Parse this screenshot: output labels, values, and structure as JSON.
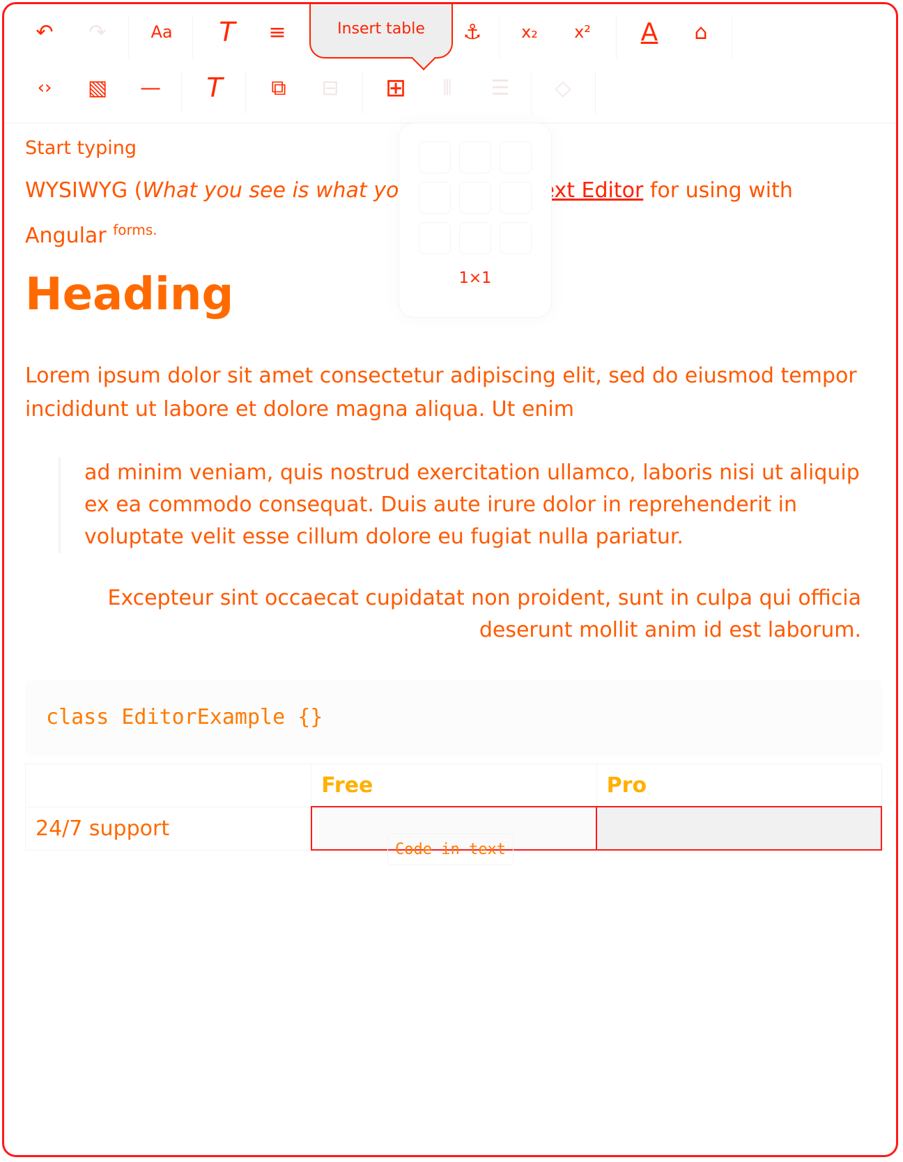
{
  "toolbar": {
    "tooltip": "Insert table",
    "row1": [
      {
        "name": "undo-icon",
        "glyph": "↶"
      },
      {
        "name": "redo-icon",
        "glyph": "↷"
      },
      {
        "name": "font-size-icon",
        "glyph": "Aa"
      },
      {
        "name": "clear-format-icon",
        "glyph": "T"
      },
      {
        "name": "align-icon",
        "glyph": "≡"
      },
      {
        "name": "link-icon",
        "glyph": "∂"
      },
      {
        "name": "anchor-icon",
        "glyph": "⚓"
      },
      {
        "name": "subscript-icon",
        "glyph": "x₂"
      },
      {
        "name": "superscript-icon",
        "glyph": "x²"
      },
      {
        "name": "text-color-icon",
        "glyph": "A"
      },
      {
        "name": "paint-roller-icon",
        "glyph": "⌂"
      }
    ],
    "row2": [
      {
        "name": "code-icon",
        "glyph": "‹›"
      },
      {
        "name": "image-icon",
        "glyph": "▧"
      },
      {
        "name": "horizontal-rule-icon",
        "glyph": "—"
      },
      {
        "name": "clear-format-icon-2",
        "glyph": "T"
      },
      {
        "name": "copy-icon",
        "glyph": "⧉"
      },
      {
        "name": "minus-box-icon",
        "glyph": "⊟"
      },
      {
        "name": "table-icon",
        "glyph": "⊞"
      },
      {
        "name": "column-insert-icon",
        "glyph": "⫴"
      },
      {
        "name": "row-insert-icon",
        "glyph": "☰"
      },
      {
        "name": "cell-fill-icon",
        "glyph": "◇"
      }
    ]
  },
  "table_popup": {
    "size_label": "1×1"
  },
  "content": {
    "start_typing": "Start typing",
    "p2_a": "WYSIWYG (",
    "p2_italic": "What you see is what yo",
    "p2_link": "Text Editor",
    "p2_b": " for using with",
    "p2_c": "Angular ",
    "p2_sup": "forms.",
    "heading": "Heading",
    "lorem": "Lorem ipsum dolor sit amet consectetur adipiscing elit, sed do eiusmod tempor incididunt ut labore et dolore magna aliqua. Ut enim",
    "blockquote": "ad minim veniam, quis nostrud exercitation ullamco, laboris nisi ut aliquip ex ea commodo consequat. Duis aute irure dolor in reprehenderit in voluptate velit esse cillum dolore eu fugiat nulla pariatur.",
    "right_aligned": "Excepteur sint occaecat cupidatat non proident, sunt in culpa qui officia deserunt mollit anim id est laborum.",
    "code_block": "class EditorExample {}",
    "table": {
      "headers": [
        "",
        "Free",
        "Pro"
      ],
      "row1": [
        "24/7 support",
        "",
        ""
      ]
    },
    "inline_code": "Code in text"
  }
}
